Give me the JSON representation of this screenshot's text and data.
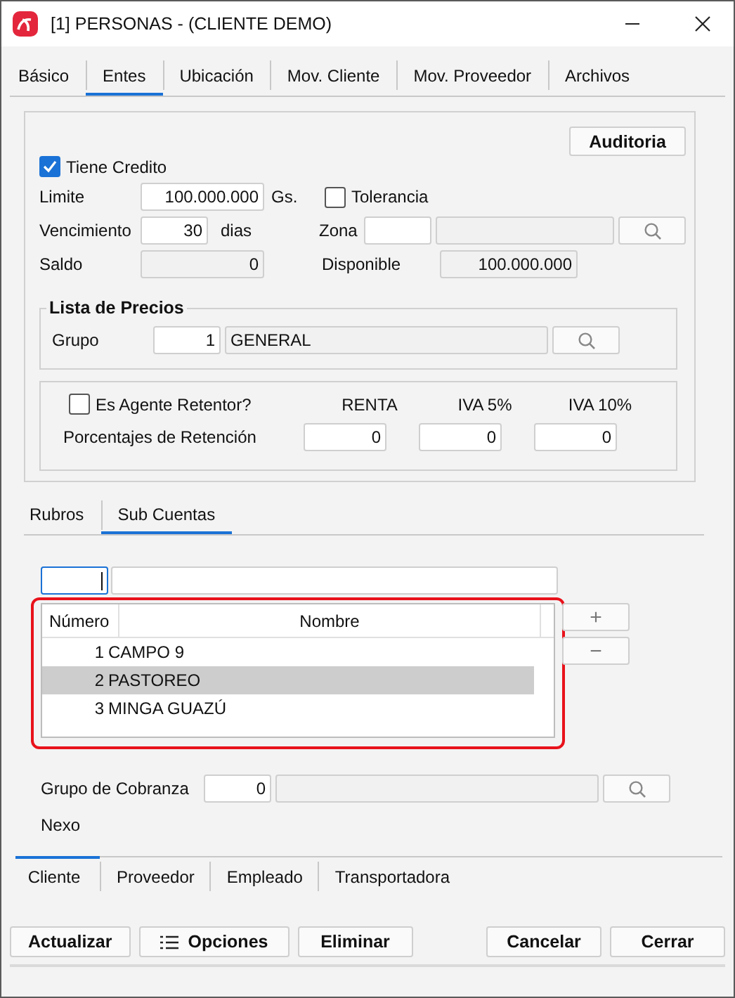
{
  "window": {
    "title": "[1] PERSONAS - (CLIENTE DEMO)"
  },
  "tabs": [
    {
      "label": "Básico",
      "selected": false
    },
    {
      "label": "Entes",
      "selected": true
    },
    {
      "label": "Ubicación",
      "selected": false
    },
    {
      "label": "Mov. Cliente",
      "selected": false
    },
    {
      "label": "Mov. Proveedor",
      "selected": false
    },
    {
      "label": "Archivos",
      "selected": false
    }
  ],
  "audit_button": "Auditoria",
  "credit": {
    "has_credit": {
      "label": "Tiene Credito",
      "checked": true
    },
    "limit": {
      "label": "Limite",
      "value": "100.000.000",
      "unit": "Gs."
    },
    "tolerance": {
      "label": "Tolerancia",
      "checked": false
    },
    "due": {
      "label": "Vencimiento",
      "value": "30",
      "unit": "dias"
    },
    "zone": {
      "label": "Zona"
    },
    "balance": {
      "label": "Saldo",
      "value": "0"
    },
    "available": {
      "label": "Disponible",
      "value": "100.000.000"
    }
  },
  "price_list": {
    "title": "Lista de Precios",
    "label": "Grupo",
    "code": "1",
    "name": "GENERAL"
  },
  "retention": {
    "agent": {
      "label": "Es Agente Retentor?",
      "checked": false
    },
    "row_label": "Porcentajes de Retención",
    "columns": [
      {
        "header": "RENTA",
        "value": "0"
      },
      {
        "header": "IVA 5%",
        "value": "0"
      },
      {
        "header": "IVA 10%",
        "value": "0"
      }
    ]
  },
  "sub_tabs": [
    {
      "label": "Rubros",
      "selected": false
    },
    {
      "label": "Sub Cuentas",
      "selected": true
    }
  ],
  "sub_accounts": {
    "columns": [
      "Número",
      "Nombre"
    ],
    "rows": [
      {
        "number": "1",
        "name": "CAMPO 9",
        "selected": false
      },
      {
        "number": "2",
        "name": "PASTOREO",
        "selected": true
      },
      {
        "number": "3",
        "name": "MINGA GUAZÚ",
        "selected": false
      }
    ],
    "add_button": "+",
    "remove_button": "−"
  },
  "collection_group": {
    "label": "Grupo de Cobranza",
    "value": "0"
  },
  "nexo": {
    "label": "Nexo",
    "tabs": [
      {
        "label": "Cliente",
        "selected": true
      },
      {
        "label": "Proveedor",
        "selected": false
      },
      {
        "label": "Empleado",
        "selected": false
      },
      {
        "label": "Transportadora",
        "selected": false
      }
    ]
  },
  "buttons_left": [
    {
      "label": "Actualizar",
      "kind": "plain"
    },
    {
      "label": "Opciones",
      "kind": "menu"
    },
    {
      "label": "Eliminar",
      "kind": "plain"
    }
  ],
  "buttons_right": [
    {
      "label": "Cancelar"
    },
    {
      "label": "Cerrar"
    }
  ]
}
